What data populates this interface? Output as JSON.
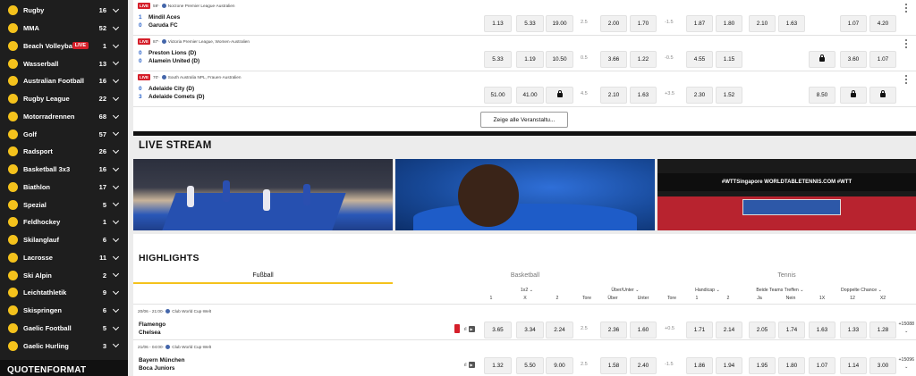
{
  "sidebar": {
    "items": [
      {
        "label": "Rugby",
        "count": "16",
        "icon": "rugby-icon"
      },
      {
        "label": "MMA",
        "count": "52",
        "icon": "mma-icon"
      },
      {
        "label": "Beach Volleyball",
        "count": "1",
        "live": "LIVE",
        "icon": "beach-volleyball-icon"
      },
      {
        "label": "Wasserball",
        "count": "13",
        "icon": "waterpolo-icon"
      },
      {
        "label": "Australian Football",
        "count": "16",
        "icon": "australian-football-icon"
      },
      {
        "label": "Rugby League",
        "count": "22",
        "icon": "rugby-league-icon"
      },
      {
        "label": "Motorradrennen",
        "count": "68",
        "icon": "motorbike-icon"
      },
      {
        "label": "Golf",
        "count": "57",
        "icon": "golf-icon"
      },
      {
        "label": "Radsport",
        "count": "26",
        "icon": "cycling-icon"
      },
      {
        "label": "Basketball 3x3",
        "count": "16",
        "icon": "basketball-icon"
      },
      {
        "label": "Biathlon",
        "count": "17",
        "icon": "biathlon-icon"
      },
      {
        "label": "Spezial",
        "count": "5",
        "icon": "special-icon"
      },
      {
        "label": "Feldhockey",
        "count": "1",
        "icon": "hockey-icon"
      },
      {
        "label": "Skilanglauf",
        "count": "6",
        "icon": "cross-country-ski-icon"
      },
      {
        "label": "Lacrosse",
        "count": "11",
        "icon": "lacrosse-icon"
      },
      {
        "label": "Ski Alpin",
        "count": "2",
        "icon": "ski-alpine-icon"
      },
      {
        "label": "Leichtathletik",
        "count": "9",
        "icon": "athletics-icon"
      },
      {
        "label": "Skispringen",
        "count": "6",
        "icon": "ski-jumping-icon"
      },
      {
        "label": "Gaelic Football",
        "count": "5",
        "icon": "gaelic-football-icon"
      },
      {
        "label": "Gaelic Hurling",
        "count": "3",
        "icon": "hurling-icon"
      }
    ],
    "quotenformat": "QUOTENFORMAT"
  },
  "live": {
    "matches": [
      {
        "live": "LIVE",
        "minute": "59'",
        "league": "Norzone Premier League",
        "country": "Australien",
        "team1": "Mindil Aces",
        "team2": "Garuda FC",
        "score1": "1",
        "score2": "0",
        "odds": [
          "1.13",
          "5.33",
          "19.00"
        ],
        "line1": "2.5",
        "ou": [
          "2.00",
          "1.70"
        ],
        "line2": "-1.5",
        "hc": [
          "1.87",
          "1.80"
        ],
        "extra": [
          "2.10",
          "1.63",
          "",
          "1.07",
          "4.20"
        ]
      },
      {
        "live": "LIVE",
        "minute": "87'",
        "league": "Victoria Premier League, Women",
        "country": "Australien",
        "team1": "Preston Lions (D)",
        "team2": "Alamein United (D)",
        "score1": "0",
        "score2": "0",
        "odds": [
          "5.33",
          "1.19",
          "10.50"
        ],
        "line1": "0.5",
        "ou": [
          "3.66",
          "1.22"
        ],
        "line2": "-0.5",
        "hc": [
          "4.55",
          "1.15"
        ],
        "extra": [
          "",
          "",
          "lock",
          "3.60",
          "1.07"
        ]
      },
      {
        "live": "LIVE",
        "minute": "70'",
        "league": "South Australia NPL, Frauen",
        "country": "Australien",
        "team1": "Adelaide City (D)",
        "team2": "Adelaide Comets (D)",
        "score1": "0",
        "score2": "3",
        "odds": [
          "51.00",
          "41.00",
          "lock"
        ],
        "line1": "4.5",
        "ou": [
          "2.10",
          "1.63"
        ],
        "line2": "+3.5",
        "hc": [
          "2.30",
          "1.52"
        ],
        "extra": [
          "",
          "",
          "8.50",
          "lock",
          "lock"
        ]
      }
    ],
    "show_all": "Zeige alle Veranstaltu..."
  },
  "livestream": {
    "title": "LIVE STREAM",
    "tiles": [
      {
        "name": "basketball-stream"
      },
      {
        "name": "soccer-stream"
      },
      {
        "name": "table-tennis-stream",
        "banner": "#WTTSingapore   WORLDTABLETENNIS.COM   #WTT"
      }
    ]
  },
  "highlights": {
    "title": "HIGHLIGHTS",
    "tabs": [
      "Fußball",
      "Basketball",
      "Tennis"
    ],
    "headers": {
      "g1": "1x2",
      "g1_cols": [
        "1",
        "X",
        "2"
      ],
      "tore1": "Tore",
      "g2": "Über/Unter",
      "g2_cols": [
        "Über",
        "Unter"
      ],
      "tore2": "Tore",
      "g3": "Handicap",
      "g3_cols": [
        "1",
        "2"
      ],
      "g4": "Beide Teams Treffen",
      "g4_cols": [
        "Ja",
        "Nein"
      ],
      "g5": "Doppelte Chance",
      "g5_cols": [
        "1X",
        "12",
        "X2"
      ]
    },
    "matches": [
      {
        "date": "20/06 - 21:00",
        "league": "Club World Cup",
        "country": "Welt",
        "team1": "Flamengo",
        "team2": "Chelsea",
        "odds": [
          "3.65",
          "3.34",
          "2.24"
        ],
        "line1": "2.5",
        "ou": [
          "2.36",
          "1.60"
        ],
        "line2": "+0.5",
        "hc": [
          "1.71",
          "2.14"
        ],
        "btt": [
          "2.05",
          "1.74"
        ],
        "dc": [
          "1.63",
          "1.33",
          "1.28"
        ],
        "more": "+15088"
      },
      {
        "date": "21/06 - 04:00",
        "league": "Club World Cup",
        "country": "Welt",
        "team1": "Bayern München",
        "team2": "Boca Juniors",
        "odds": [
          "1.32",
          "5.50",
          "9.00"
        ],
        "line1": "2.5",
        "ou": [
          "1.58",
          "2.40"
        ],
        "line2": "-1.5",
        "hc": [
          "1.86",
          "1.94"
        ],
        "btt": [
          "1.95",
          "1.80"
        ],
        "dc": [
          "1.07",
          "1.14",
          "3.00"
        ],
        "more": "+15096"
      }
    ]
  },
  "colors": {
    "accent": "#f4c21c",
    "live": "#d51f2a",
    "sidebar": "#1e1e1e",
    "score": "#2a62c9"
  }
}
